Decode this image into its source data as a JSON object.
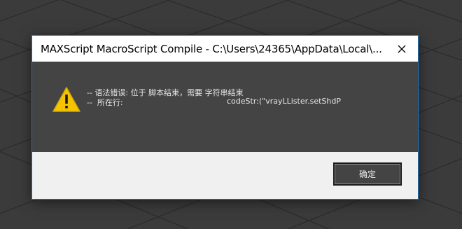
{
  "dialog": {
    "title": "MAXScript MacroScript Compile - C:\\Users\\24365\\AppData\\Local\\...",
    "message_line1": "-- 语法错误: 位于 脚本结束，需要 字符串结束",
    "message_line2": "--  所在行:",
    "code_excerpt": "codeStr:(\"vrayLLister.setShdP",
    "ok_label": "确定"
  },
  "icons": {
    "warning": "warning-icon",
    "close": "close-icon"
  },
  "colors": {
    "accent_border": "#1e73be",
    "warning_yellow": "#f5c400",
    "dialog_body": "#444444",
    "footer": "#f0f0f0"
  }
}
